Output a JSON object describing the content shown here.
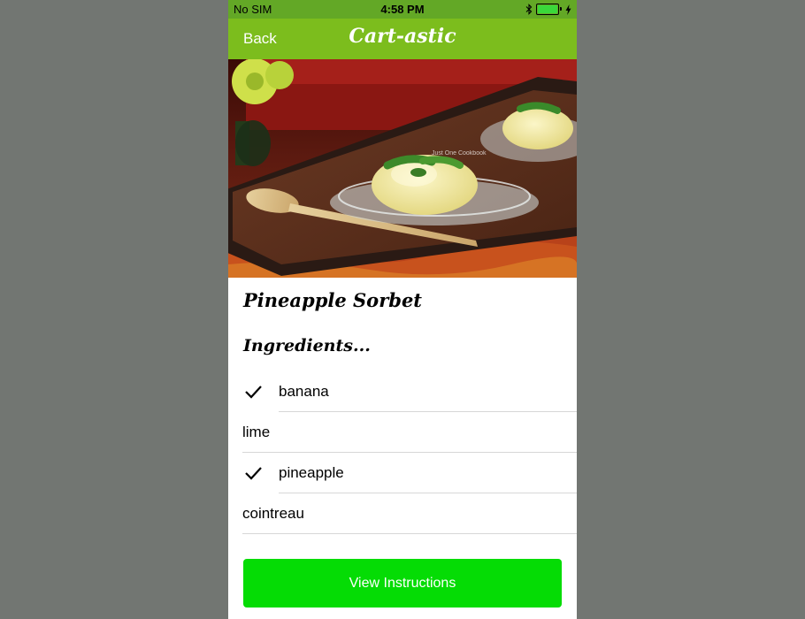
{
  "status_bar": {
    "carrier": "No SIM",
    "time": "4:58 PM",
    "battery_level": 1.0
  },
  "nav": {
    "back_label": "Back",
    "title": "Cart-astic"
  },
  "recipe": {
    "title": "Pineapple Sorbet",
    "image_watermark": "Just One Cookbook"
  },
  "ingredients_heading": "Ingredients...",
  "ingredients": [
    {
      "name": "banana",
      "checked": true
    },
    {
      "name": "lime",
      "checked": false
    },
    {
      "name": "pineapple",
      "checked": true
    },
    {
      "name": "cointreau",
      "checked": false
    }
  ],
  "view_instructions_label": "View Instructions",
  "colors": {
    "status_bar": "#63a826",
    "nav_bar": "#7cbd1d",
    "button": "#05dc05",
    "backdrop": "#727672"
  },
  "icons": [
    "bluetooth-icon",
    "battery-icon",
    "charging-bolt-icon",
    "checkmark-icon"
  ]
}
